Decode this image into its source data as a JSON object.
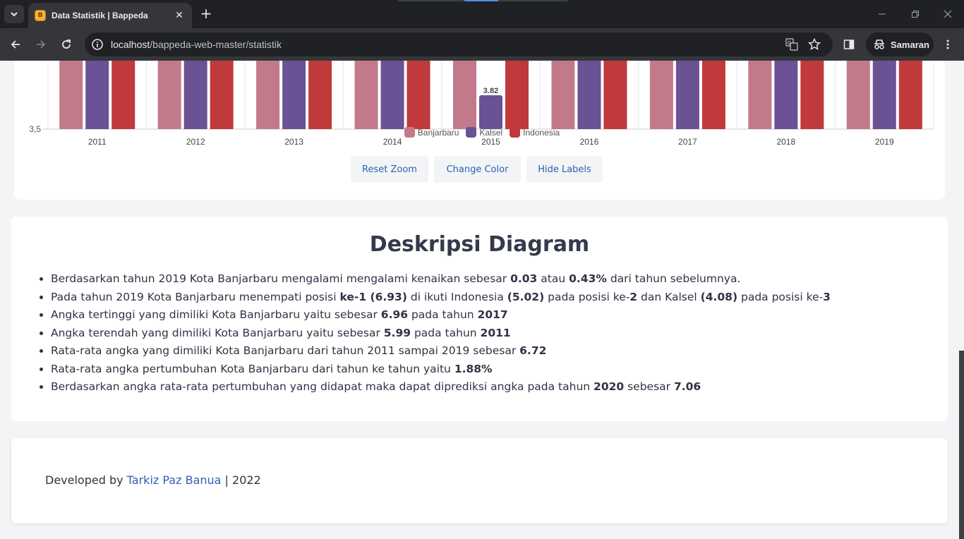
{
  "browser": {
    "tab_title": "Data Statistik | Bappeda",
    "favicon_text": "B",
    "url_host": "localhost",
    "url_path": "/bappeda-web-master/statistik",
    "profile_label": "Samaran",
    "chrome_bg": "#202124",
    "toolbar_bg": "#35363a"
  },
  "chart_data": {
    "type": "bar",
    "categories": [
      "2011",
      "2012",
      "2013",
      "2014",
      "2015",
      "2016",
      "2017",
      "2018",
      "2019"
    ],
    "ylim": [
      3.5,
      null
    ],
    "yticks": [
      "3,5"
    ],
    "series": [
      {
        "name": "Banjarbaru",
        "color": "#c27a8a"
      },
      {
        "name": "Kalsel",
        "color": "#6b5294"
      },
      {
        "name": "Indonesia",
        "color": "#c0393b"
      }
    ],
    "data_labels": [
      {
        "series": "Kalsel",
        "category": "2015",
        "text": "3.82"
      }
    ],
    "legend_position": "bottom"
  },
  "chart_controls": {
    "reset_zoom": "Reset Zoom",
    "change_color": "Change Color",
    "hide_labels": "Hide Labels"
  },
  "description": {
    "title": "Deskripsi Diagram",
    "items": [
      {
        "t1": "Berdasarkan tahun 2019 Kota Banjarbaru mengalami mengalami kenaikan sebesar ",
        "b1": "0.03",
        "t2": " atau ",
        "b2": "0.43%",
        "t3": " dari tahun sebelumnya."
      },
      {
        "t1": "Pada tahun 2019 Kota Banjarbaru menempati posisi ",
        "b1": "ke-1 (6.93)",
        "t2": " di ikuti Indonesia ",
        "b2": "(5.02)",
        "t3": " pada posisi ke-",
        "b3": "2",
        "t4": " dan Kalsel ",
        "b4": "(4.08)",
        "t5": " pada posisi ke-",
        "b5": "3"
      },
      {
        "t1": "Angka tertinggi yang dimiliki Kota Banjarbaru yaitu sebesar ",
        "b1": "6.96",
        "t2": " pada tahun ",
        "b2": "2017"
      },
      {
        "t1": "Angka terendah yang dimiliki Kota Banjarbaru yaitu sebesar ",
        "b1": "5.99",
        "t2": " pada tahun ",
        "b2": "2011"
      },
      {
        "t1": "Rata-rata angka yang dimiliki Kota Banjarbaru dari tahun 2011 sampai 2019 sebesar ",
        "b1": "6.72"
      },
      {
        "t1": "Rata-rata angka pertumbuhan Kota Banjarbaru dari tahun ke tahun yaitu ",
        "b1": "1.88%"
      },
      {
        "t1": "Berdasarkan angka rata-rata pertumbuhan yang didapat maka dapat diprediksi angka pada tahun ",
        "b1": "2020",
        "t2": " sebesar ",
        "b2": "7.06"
      }
    ]
  },
  "footer": {
    "prefix": "Developed by ",
    "author": "Tarkiz Paz Banua",
    "suffix": " | 2022"
  }
}
